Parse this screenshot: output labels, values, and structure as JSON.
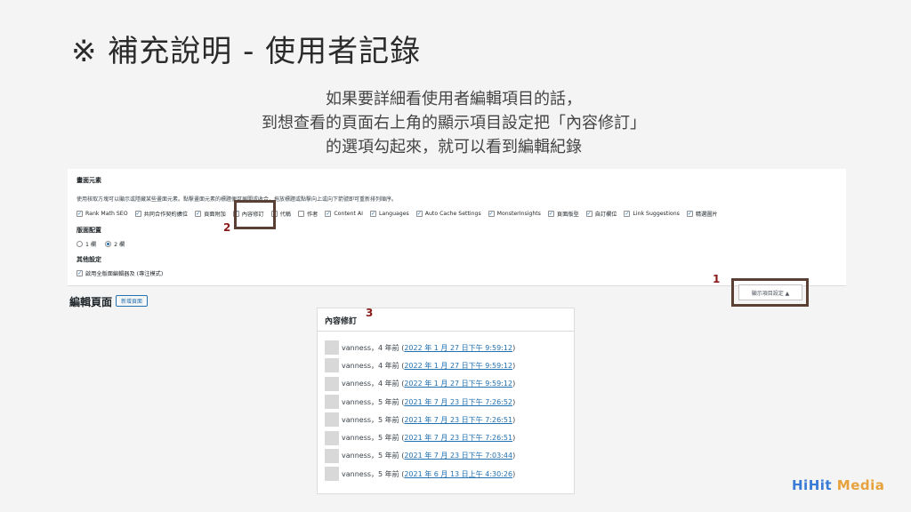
{
  "slide": {
    "title": "※ 補充說明 - 使用者記錄",
    "explanation": [
      "如果要詳細看使用者編輯項目的話，",
      "到想查看的頁面右上角的顯示項目設定把「內容修訂」",
      "的選項勾起來，就可以看到編輯紀錄"
    ]
  },
  "screen_options": {
    "section_title": "畫面元素",
    "description": "使用核取方塊可以顯示或隱藏某些畫面元素。點擊畫面元素的標題便可展開或收合，拖放標題或點擊向上或向下箭號即可重新排列順序。",
    "boxes": [
      {
        "label": "Rank Math SEO",
        "checked": true
      },
      {
        "label": "共同合作契約擴位",
        "checked": true
      },
      {
        "label": "頁面附加",
        "checked": true
      },
      {
        "label": "內容修訂",
        "checked": true
      },
      {
        "label": "代稱",
        "checked": false
      },
      {
        "label": "作者",
        "checked": false
      },
      {
        "label": "Content AI",
        "checked": true
      },
      {
        "label": "Languages",
        "checked": true
      },
      {
        "label": "Auto Cache Settings",
        "checked": true
      },
      {
        "label": "MonsterInsights",
        "checked": true
      },
      {
        "label": "頁面版型",
        "checked": true
      },
      {
        "label": "自訂欄位",
        "checked": true
      },
      {
        "label": "Link Suggestions",
        "checked": true
      },
      {
        "label": "精選圖片",
        "checked": true
      }
    ],
    "layout_title": "版面配置",
    "layout_options": [
      {
        "label": "1 欄",
        "selected": false
      },
      {
        "label": "2 欄",
        "selected": true
      }
    ],
    "other_title": "其他設定",
    "fullscreen_label": "啟用全版面編輯器及 (專注模式)",
    "toggle_button": "顯示項目設定 ▲"
  },
  "page": {
    "heading": "編輯頁面",
    "new_page_button": "新增頁面"
  },
  "steps": {
    "one": "1",
    "two": "2",
    "three": "3"
  },
  "revisions": {
    "title": "內容修訂",
    "items": [
      {
        "user": "vanness",
        "ago": "，4 年前 (",
        "date": "2022 年 1 月 27 日下午 9:59:12",
        "close": ")"
      },
      {
        "user": "vanness",
        "ago": "，4 年前 (",
        "date": "2022 年 1 月 27 日下午 9:59:12",
        "close": ")"
      },
      {
        "user": "vanness",
        "ago": "，4 年前 (",
        "date": "2022 年 1 月 27 日下午 9:59:12",
        "close": ")"
      },
      {
        "user": "vanness",
        "ago": "，5 年前 (",
        "date": "2021 年 7 月 23 日下午 7:26:52",
        "close": ")"
      },
      {
        "user": "vanness",
        "ago": "，5 年前 (",
        "date": "2021 年 7 月 23 日下午 7:26:51",
        "close": ")"
      },
      {
        "user": "vanness",
        "ago": "，5 年前 (",
        "date": "2021 年 7 月 23 日下午 7:26:51",
        "close": ")"
      },
      {
        "user": "vanness",
        "ago": "，5 年前 (",
        "date": "2021 年 7 月 23 日下午 7:03:44",
        "close": ")"
      },
      {
        "user": "vanness",
        "ago": "，5 年前 (",
        "date": "2021 年 6 月 13 日上午 4:30:26",
        "close": ")"
      }
    ]
  },
  "logo": {
    "part1": "HiHit",
    "part2": "Media"
  }
}
